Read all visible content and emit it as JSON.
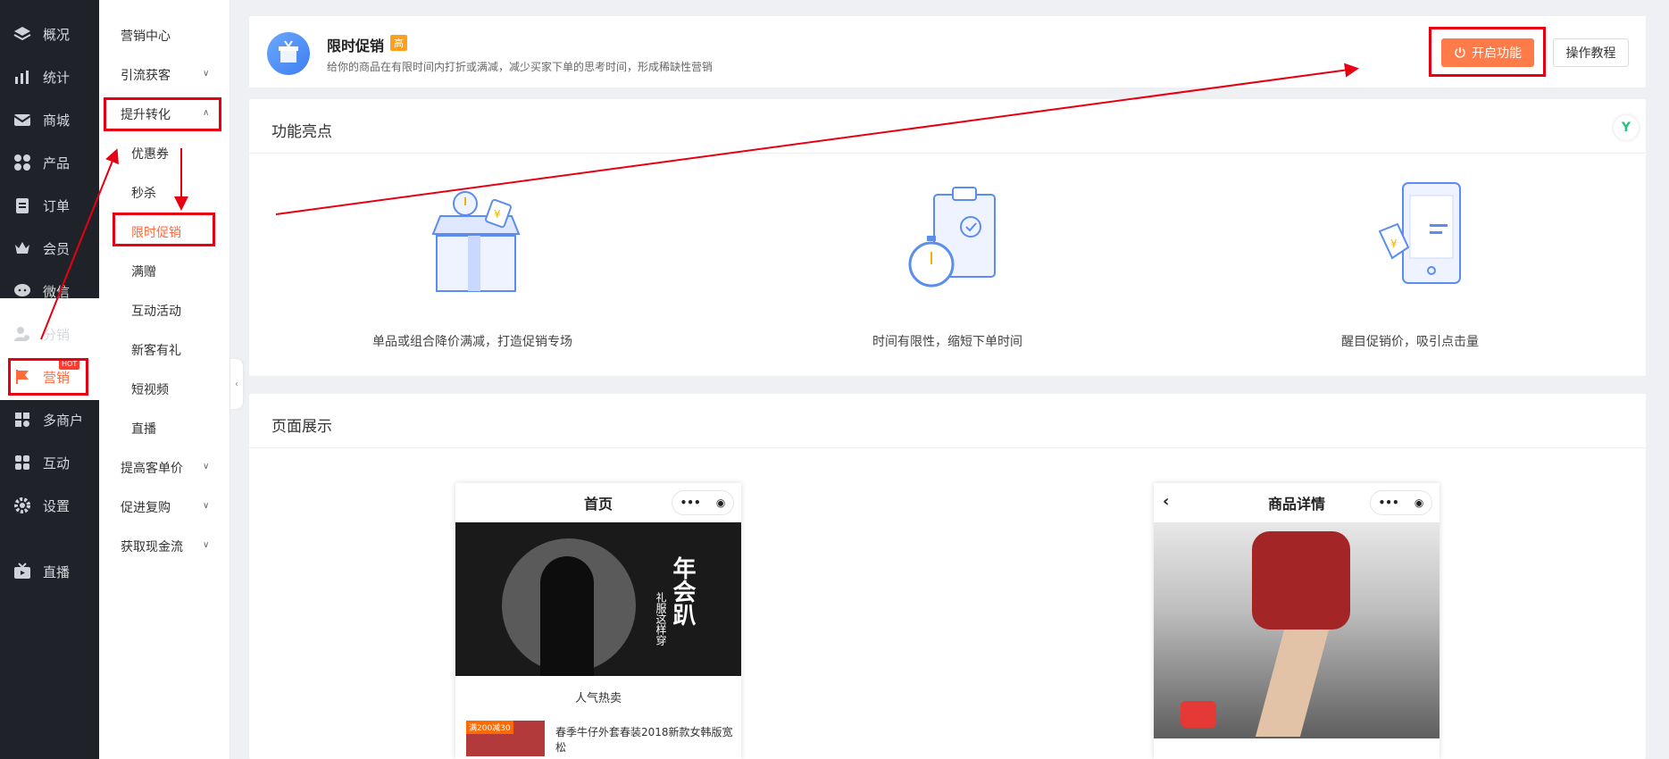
{
  "nav": {
    "items": [
      {
        "label": "概况",
        "icon": "layers-icon"
      },
      {
        "label": "统计",
        "icon": "chart-icon"
      },
      {
        "label": "商城",
        "icon": "mail-icon"
      },
      {
        "label": "产品",
        "icon": "grid-icon"
      },
      {
        "label": "订单",
        "icon": "clipboard-icon"
      },
      {
        "label": "会员",
        "icon": "crown-icon"
      },
      {
        "label": "微信",
        "icon": "wechat-icon"
      },
      {
        "label": "分销",
        "icon": "users-icon"
      },
      {
        "label": "营销",
        "icon": "flag-icon",
        "badge": "HOT"
      },
      {
        "label": "多商户",
        "icon": "store-icon"
      },
      {
        "label": "互动",
        "icon": "apps-icon"
      },
      {
        "label": "设置",
        "icon": "gear-icon"
      },
      {
        "label": "直播",
        "icon": "tv-icon"
      }
    ]
  },
  "submenu": {
    "items": [
      {
        "label": "营销中心"
      },
      {
        "label": "引流获客"
      },
      {
        "label": "提升转化"
      },
      {
        "label": "优惠券"
      },
      {
        "label": "秒杀"
      },
      {
        "label": "限时促销"
      },
      {
        "label": "满赠"
      },
      {
        "label": "互动活动"
      },
      {
        "label": "新客有礼"
      },
      {
        "label": "短视频"
      },
      {
        "label": "直播"
      },
      {
        "label": "提高客单价"
      },
      {
        "label": "促进复购"
      },
      {
        "label": "获取现金流"
      }
    ]
  },
  "feature": {
    "title": "限时促销",
    "tag": "高",
    "description": "给你的商品在有限时间内打折或满减，减少买家下单的思考时间，形成稀缺性营销",
    "enable_label": "开启功能",
    "tutorial_label": "操作教程"
  },
  "highlights": {
    "title": "功能亮点",
    "items": [
      {
        "caption": "单品或组合降价满减，打造促销专场"
      },
      {
        "caption": "时间有限性，缩短下单时间"
      },
      {
        "caption": "醒目促销价，吸引点击量"
      }
    ]
  },
  "showcase": {
    "title": "页面展示",
    "phone1": {
      "title": "首页",
      "banner_text": "年会趴",
      "banner_sub": "礼服这样穿",
      "section": "人气热卖",
      "tag": "满200减30",
      "product": "春季牛仔外套春装2018新款女韩版宽松"
    },
    "phone2": {
      "title": "商品详情"
    }
  },
  "colors": {
    "accent": "#ff7b4a",
    "sidebar": "#1f2329",
    "annotation": "#e60012"
  }
}
